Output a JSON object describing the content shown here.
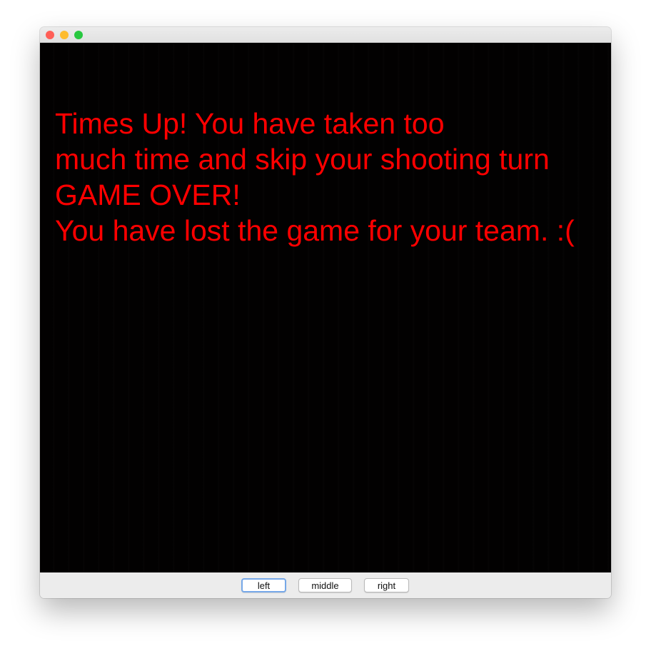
{
  "window": {
    "controls": {
      "close_color": "#ff5f57",
      "minimize_color": "#febc2e",
      "zoom_color": "#28c840"
    }
  },
  "game": {
    "background_color": "#020101",
    "message_color": "#ff0000",
    "message_lines": [
      "Times Up! You have taken too",
      "much time and skip your shooting turn",
      "GAME OVER!",
      "You have lost the game for your team. :("
    ]
  },
  "buttons": {
    "left": "left",
    "middle": "middle",
    "right": "right"
  }
}
